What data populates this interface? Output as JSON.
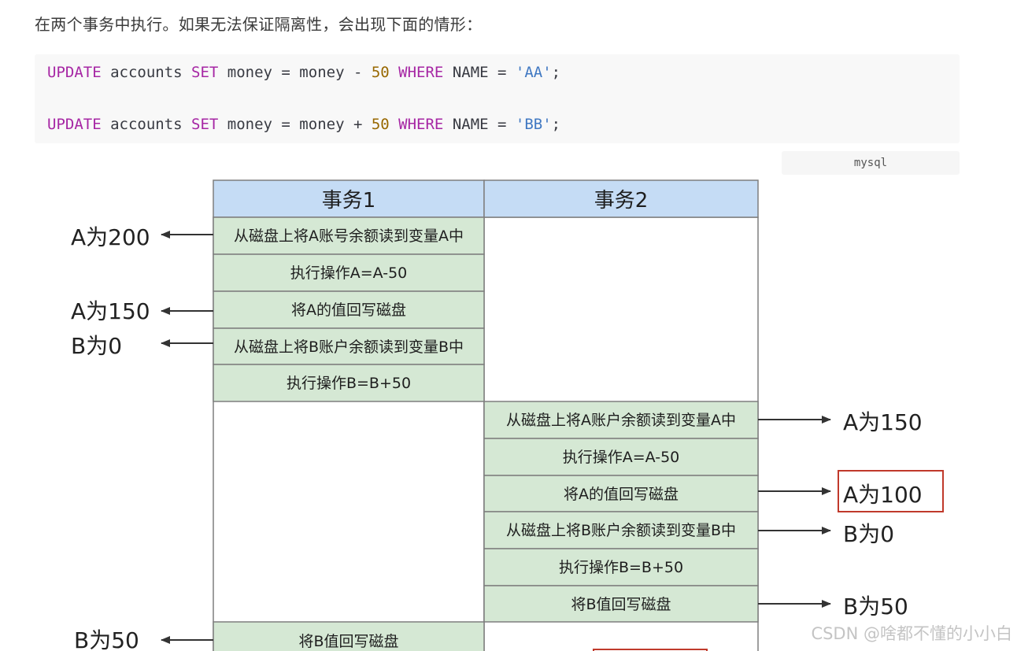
{
  "intro_text": "在两个事务中执行。如果无法保证隔离性，会出现下面的情形：",
  "code_block": {
    "lang": "mysql",
    "line1": {
      "kw1": "UPDATE",
      "t1": " accounts ",
      "kw2": "SET",
      "t2": " money = money - ",
      "num": "50",
      "t3": " ",
      "kw3": "WHERE",
      "t4": " NAME = ",
      "str": "'AA'",
      "t5": ";"
    },
    "line2": {
      "kw1": "UPDATE",
      "t1": " accounts ",
      "kw2": "SET",
      "t2": " money = money + ",
      "num": "50",
      "t3": " ",
      "kw3": "WHERE",
      "t4": " NAME = ",
      "str": "'BB'",
      "t5": ";"
    }
  },
  "diagram": {
    "header_tx1": "事务1",
    "header_tx2": "事务2",
    "tx1_steps": [
      "从磁盘上将A账号余额读到变量A中",
      "执行操作A=A-50",
      "将A的值回写磁盘",
      "从磁盘上将B账户余额读到变量B中",
      "执行操作B=B+50"
    ],
    "tx2_steps": [
      "从磁盘上将A账户余额读到变量A中",
      "执行操作A=A-50",
      "将A的值回写磁盘",
      "从磁盘上将B账户余额读到变量B中",
      "执行操作B=B+50",
      "将B值回写磁盘"
    ],
    "tx1_final_step": "将B值回写磁盘",
    "left_labels": [
      "A为200",
      "A为150",
      "B为0",
      "B为50"
    ],
    "right_labels": [
      "A为150",
      "A为100",
      "B为0",
      "B为50"
    ],
    "colors": {
      "header_fill": "#c5dcf5",
      "step_fill": "#d5e8d4",
      "border": "#7f7f7f",
      "highlight_box": "#c0392b"
    }
  },
  "watermark": "CSDN @啥都不懂的小小白"
}
